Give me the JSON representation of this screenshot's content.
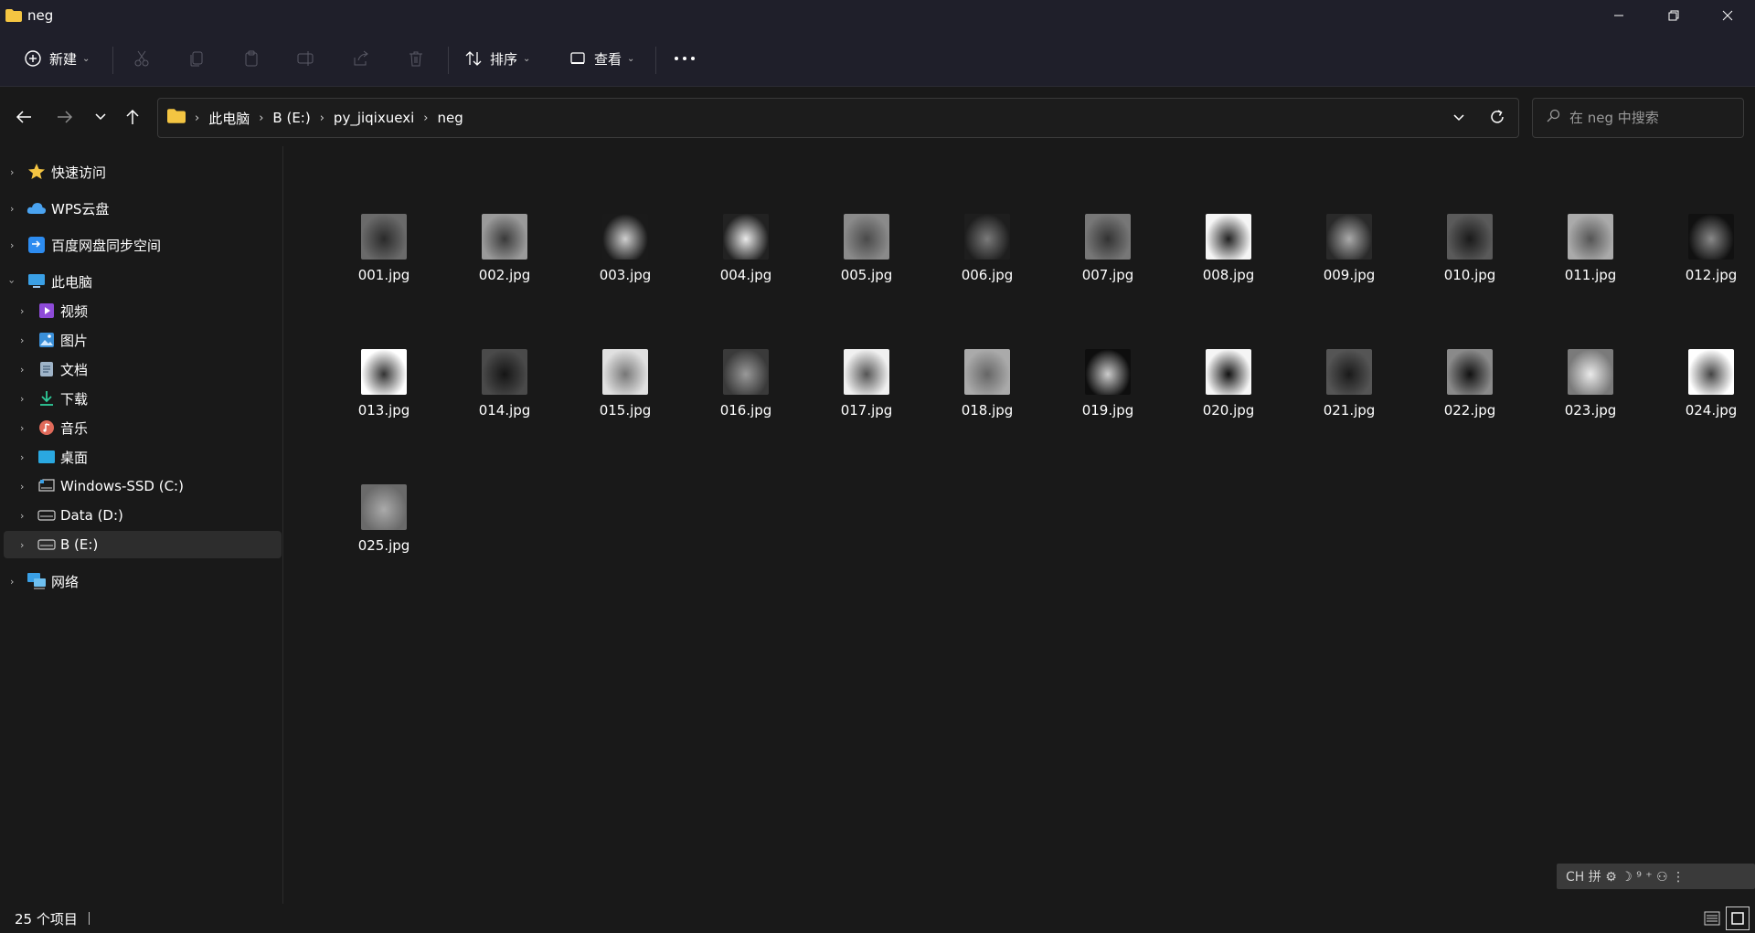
{
  "window": {
    "title": "neg"
  },
  "toolbar": {
    "new_label": "新建",
    "sort_label": "排序",
    "view_label": "查看"
  },
  "address": {
    "crumbs": [
      "此电脑",
      "B (E:)",
      "py_jiqixuexi",
      "neg"
    ]
  },
  "search": {
    "placeholder": "在 neg 中搜索"
  },
  "sidebar": {
    "items": [
      {
        "label": "快速访问",
        "icon": "star-icon"
      },
      {
        "label": "WPS云盘",
        "icon": "cloud-icon"
      },
      {
        "label": "百度网盘同步空间",
        "icon": "baidu-sync-icon"
      },
      {
        "label": "此电脑",
        "icon": "computer-icon"
      },
      {
        "label": "视频",
        "icon": "video-folder-icon"
      },
      {
        "label": "图片",
        "icon": "pictures-folder-icon"
      },
      {
        "label": "文档",
        "icon": "documents-folder-icon"
      },
      {
        "label": "下载",
        "icon": "download-icon"
      },
      {
        "label": "音乐",
        "icon": "music-icon"
      },
      {
        "label": "桌面",
        "icon": "desktop-icon"
      },
      {
        "label": "Windows-SSD (C:)",
        "icon": "drive-c-icon"
      },
      {
        "label": "Data (D:)",
        "icon": "drive-icon"
      },
      {
        "label": "B (E:)",
        "icon": "drive-icon"
      },
      {
        "label": "网络",
        "icon": "network-icon"
      }
    ]
  },
  "files": [
    "001.jpg",
    "002.jpg",
    "003.jpg",
    "004.jpg",
    "005.jpg",
    "006.jpg",
    "007.jpg",
    "008.jpg",
    "009.jpg",
    "010.jpg",
    "011.jpg",
    "012.jpg",
    "013.jpg",
    "014.jpg",
    "015.jpg",
    "016.jpg",
    "017.jpg",
    "018.jpg",
    "019.jpg",
    "020.jpg",
    "021.jpg",
    "022.jpg",
    "023.jpg",
    "024.jpg",
    "025.jpg"
  ],
  "status": {
    "item_count": "25 个项目"
  },
  "ime": {
    "text": "CH 拼 ⚙ ☽ ⁹ ⁺ ⚇ ⋮"
  },
  "colors": {
    "folder": "#f4c542",
    "accent": "#4cc2ff"
  }
}
